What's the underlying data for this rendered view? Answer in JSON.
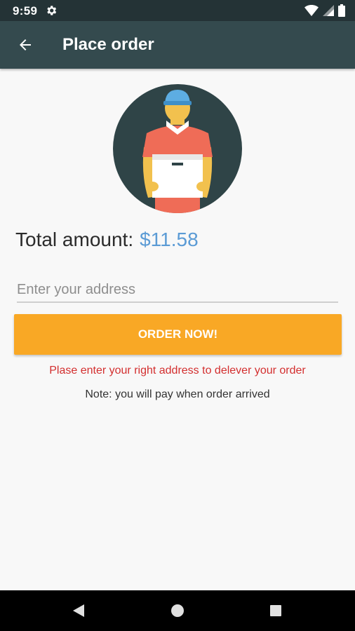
{
  "status_bar": {
    "time": "9:59",
    "icons": [
      "settings-gear-icon",
      "wifi-icon",
      "cell-signal-icon",
      "battery-icon"
    ]
  },
  "app_bar": {
    "title": "Place order",
    "back_icon": "arrow-back-icon"
  },
  "illustration": {
    "name": "delivery-man-illustration",
    "bg_color": "#2f4447"
  },
  "order": {
    "total_label": "Total amount:",
    "total_value": "$11.58",
    "address_placeholder": "Enter your address",
    "address_value": "",
    "order_button_label": "ORDER NOW!",
    "error_message": "Plase enter your right address to delever your order",
    "note": "Note: you will pay when order arrived"
  },
  "colors": {
    "status_bar": "#243336",
    "app_bar": "#344a4e",
    "accent_button": "#f9a825",
    "price": "#5b9bd5",
    "error": "#d32f2f"
  },
  "nav_bar": {
    "back": "nav-back-icon",
    "home": "nav-home-icon",
    "recents": "nav-recents-icon"
  }
}
